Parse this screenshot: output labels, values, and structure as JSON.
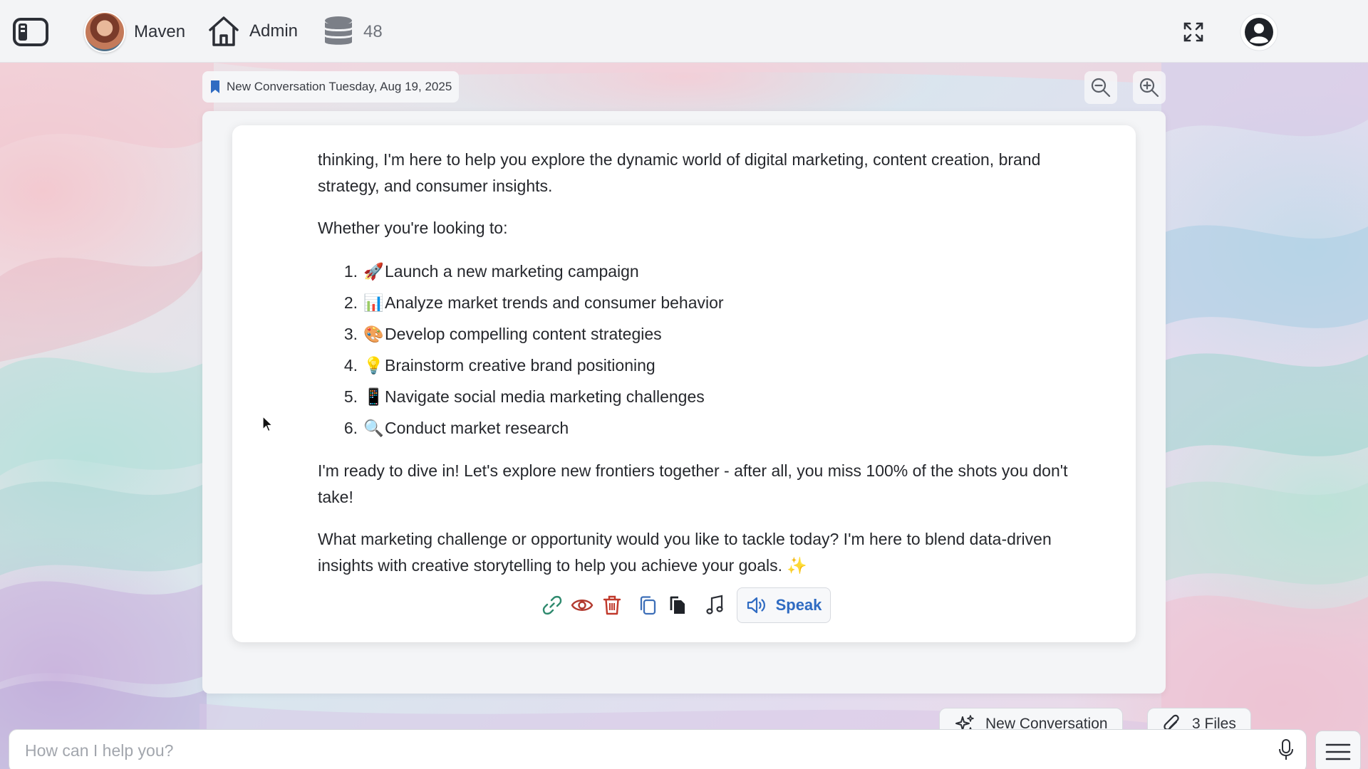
{
  "topbar": {
    "assistant_name": "Maven",
    "admin_label": "Admin",
    "credits_count": "48"
  },
  "conversation": {
    "title": "New Conversation Tuesday, Aug 19, 2025"
  },
  "message": {
    "intro": "thinking, I'm here to help you explore the dynamic world of digital marketing, content creation, brand strategy, and consumer insights.",
    "lead": "Whether you're looking to:",
    "items": [
      {
        "num": "1.",
        "emoji": "🚀",
        "text": "Launch a new marketing campaign"
      },
      {
        "num": "2.",
        "emoji": "📊",
        "text": "Analyze market trends and consumer behavior"
      },
      {
        "num": "3.",
        "emoji": "🎨",
        "text": "Develop compelling content strategies"
      },
      {
        "num": "4.",
        "emoji": "💡",
        "text": "Brainstorm creative brand positioning"
      },
      {
        "num": "5.",
        "emoji": "📱",
        "text": "Navigate social media marketing challenges"
      },
      {
        "num": "6.",
        "emoji": "🔍",
        "text": "Conduct market research"
      }
    ],
    "p2": "I'm ready to dive in! Let's explore new frontiers together - after all, you miss 100% of the shots you don't take!",
    "p3": "What marketing challenge or opportunity would you like to tackle today? I'm here to blend data-driven insights with creative storytelling to help you achieve your goals. ✨"
  },
  "actions": {
    "speak_label": "Speak"
  },
  "bottom": {
    "new_conversation_label": "New Conversation",
    "files_label": "3 Files",
    "input_placeholder": "How can I help you?"
  },
  "colors": {
    "accent_blue": "#2f6bc2",
    "delete_red": "#c0392b",
    "bookmark_blue": "#2f6bc2"
  }
}
